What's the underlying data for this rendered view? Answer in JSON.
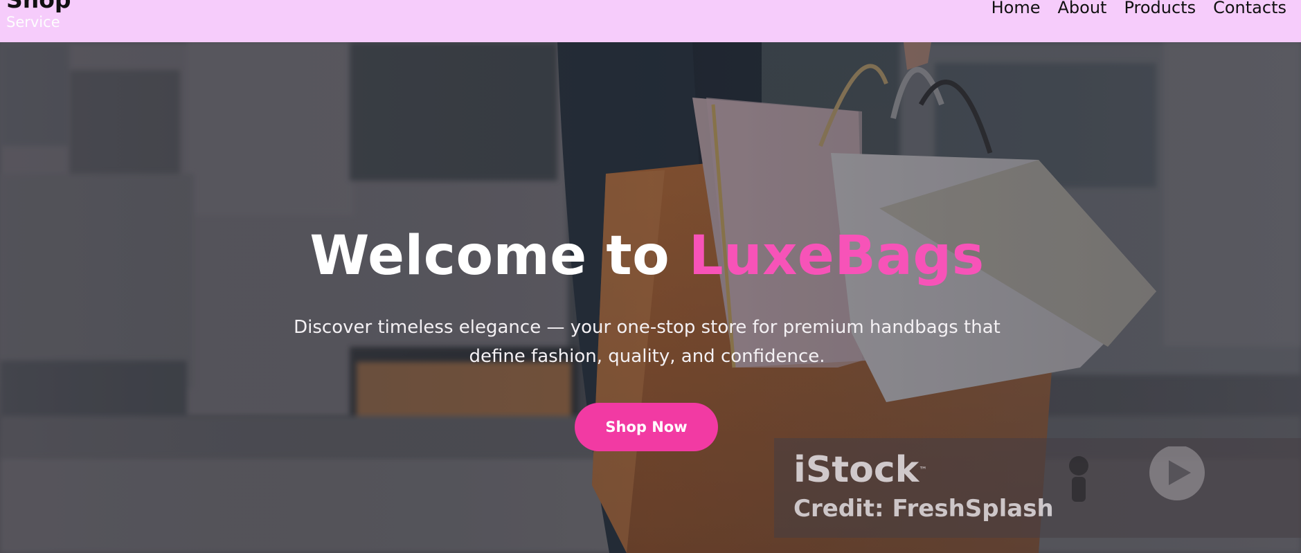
{
  "header": {
    "brand_title": "Shop",
    "brand_subtitle": "Service",
    "nav": [
      {
        "label": "Home"
      },
      {
        "label": "About"
      },
      {
        "label": "Products"
      },
      {
        "label": "Contacts"
      }
    ]
  },
  "hero": {
    "title_prefix": "Welcome to ",
    "title_accent": "LuxeBags",
    "subtitle": "Discover timeless elegance — your one-stop store for premium handbags that define fashion, quality, and confidence.",
    "cta_label": "Shop Now"
  },
  "watermark": {
    "logo": "iStock",
    "trademark": "™",
    "credit": "Credit: FreshSplash"
  },
  "colors": {
    "header_bg": "#f6ccfb",
    "accent": "#f753b8",
    "cta_bg": "#f23aa3"
  },
  "icons": [
    "play-icon",
    "person-icon"
  ]
}
